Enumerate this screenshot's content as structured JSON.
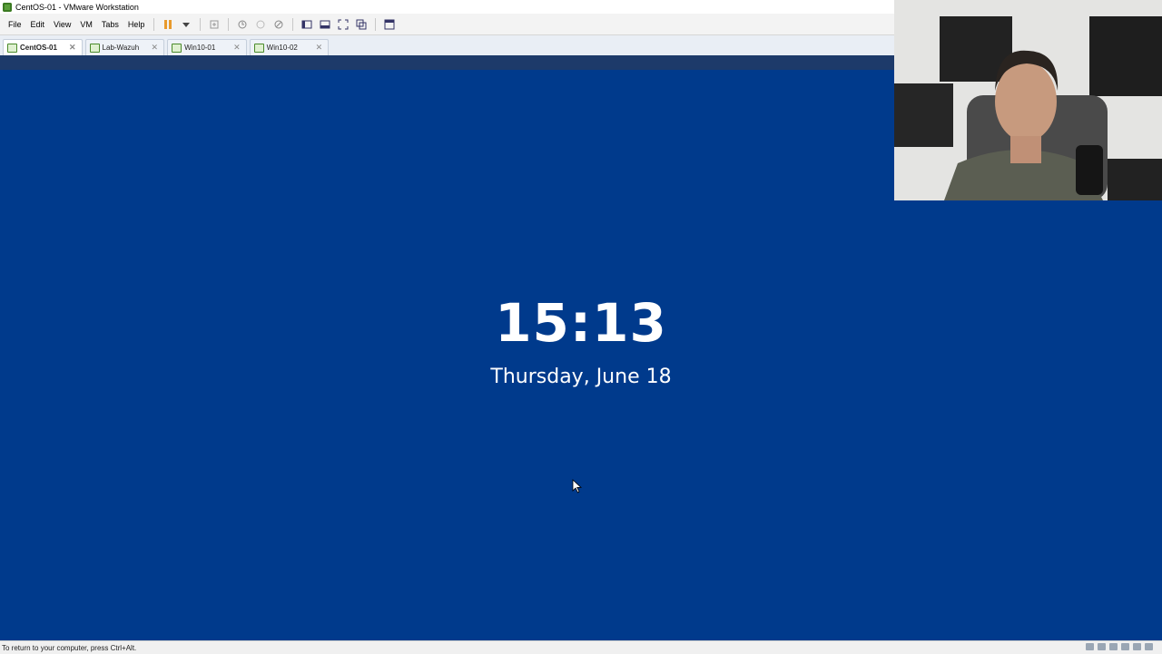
{
  "window": {
    "title": "CentOS-01 - VMware Workstation"
  },
  "menu": [
    "File",
    "Edit",
    "View",
    "VM",
    "Tabs",
    "Help"
  ],
  "toolbar_icons": [
    "pause-icon",
    "dropdown-arrow-icon",
    "send-ctrl-alt-del-icon",
    "snapshot-icon",
    "revert-snapshot-icon",
    "manage-snapshots-icon",
    "show-library-icon",
    "thumbnail-bar-icon",
    "full-screen-icon",
    "unity-icon",
    "console-view-icon"
  ],
  "tabs": [
    {
      "label": "CentOS-01",
      "active": true
    },
    {
      "label": "Lab-Wazuh",
      "active": false
    },
    {
      "label": "Win10-01",
      "active": false
    },
    {
      "label": "Win10-02",
      "active": false
    }
  ],
  "lockscreen": {
    "time": "15:13",
    "date": "Thursday, June 18"
  },
  "status": {
    "text": "To return to your computer, press Ctrl+Alt."
  },
  "colors": {
    "vm_background": "#003a8c",
    "vm_topbar": "#1d3a6a",
    "text": "#ffffff"
  }
}
